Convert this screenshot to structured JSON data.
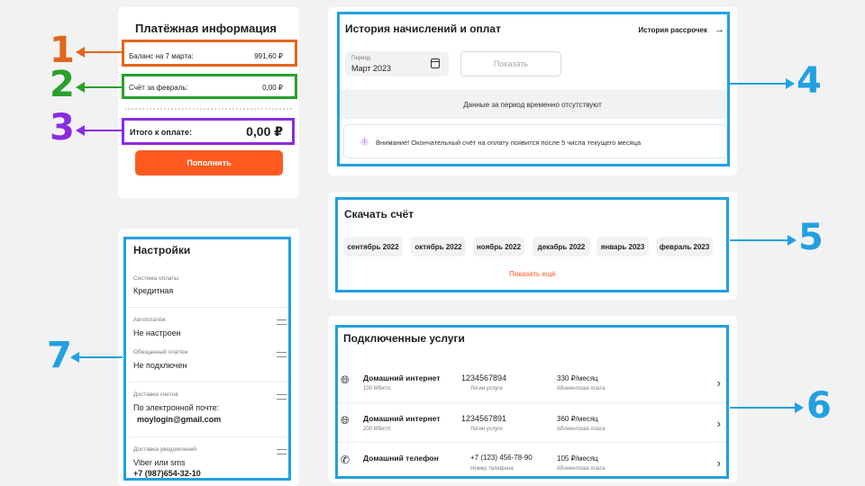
{
  "payment": {
    "title": "Платёжная информация",
    "balance_label": "Баланс на 7 марта:",
    "balance_value": "991,60 ₽",
    "bill_label": "Счёт за февраль:",
    "bill_value": "0,00 ₽",
    "total_label": "Итого к оплате:",
    "total_value": "0,00 ₽",
    "topup_button": "Пополнить"
  },
  "history": {
    "title": "История начислений и оплат",
    "installments_link": "История рассрочек",
    "period_label": "Период",
    "period_value": "Март 2023",
    "show_button": "Показать",
    "no_data": "Данные за период временно отсутствуют",
    "notice": "Внимание! Окончательный счёт на оплату появится после 5 числа текущего месяца"
  },
  "download": {
    "title": "Скачать счёт",
    "months": [
      "сентябрь 2022",
      "октябрь 2022",
      "ноябрь 2022",
      "декабрь 2022",
      "январь 2023",
      "февраль 2023"
    ],
    "show_more": "Показать ещё"
  },
  "services": {
    "title": "Подключенные услуги",
    "items": [
      {
        "icon": "globe-icon",
        "name": "Домашний интернет",
        "speed": "100 Мбит/с",
        "number": "1234567894",
        "number_label": "Логин услуги",
        "price": "330 ₽/месяц",
        "price_label": "Абонентская плата"
      },
      {
        "icon": "globe-icon",
        "name": "Домашний интернет",
        "speed": "200 Мбит/с",
        "number": "1234567891",
        "number_label": "Логин услуги",
        "price": "360 ₽/месяц",
        "price_label": "Абонентская плата"
      },
      {
        "icon": "phone-icon",
        "name": "Домашний телефон",
        "speed": "",
        "number": "+7 (123) 456-78-90",
        "number_label": "Номер телефона",
        "price": "105 ₽/месяц",
        "price_label": "Абонентская плата"
      }
    ]
  },
  "settings": {
    "title": "Настройки",
    "payment_system_label": "Система оплаты",
    "payment_system_value": "Кредитная",
    "autopay_label": "Автоплатёж",
    "autopay_value": "Не настроен",
    "promised_label": "Обещанный платёж",
    "promised_value": "Не подключен",
    "delivery_label": "Доставка счетов",
    "delivery_value": "По электронной почте:",
    "delivery_email": "moylogin@gmail.com",
    "notify_label": "Доставка уведомлений",
    "notify_value": "Viber или sms",
    "notify_phone": "+7 (987)654-32-10"
  },
  "annotations": {
    "n1": "1",
    "n2": "2",
    "n3": "3",
    "n4": "4",
    "n5": "5",
    "n6": "6",
    "n7": "7"
  },
  "colors": {
    "accent": "#fe5a20",
    "box1": "#e0661b",
    "box2": "#2aa02a",
    "box3": "#8a2be2",
    "box_blue": "#22a0e0"
  }
}
